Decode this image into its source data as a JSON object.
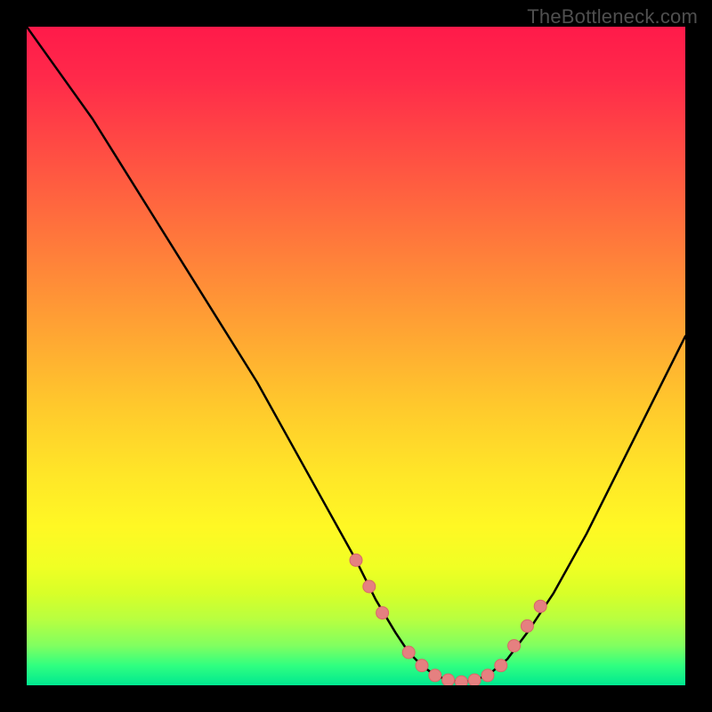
{
  "watermark": "TheBottleneck.com",
  "chart_data": {
    "type": "line",
    "title": "",
    "xlabel": "",
    "ylabel": "",
    "xlim": [
      0,
      100
    ],
    "ylim": [
      0,
      100
    ],
    "grid": false,
    "legend": false,
    "series": [
      {
        "name": "curve",
        "x": [
          0,
          5,
          10,
          15,
          20,
          25,
          30,
          35,
          40,
          45,
          50,
          53,
          56,
          58,
          60,
          62,
          64,
          66,
          68,
          70,
          73,
          76,
          80,
          85,
          90,
          95,
          100
        ],
        "y": [
          100,
          93,
          86,
          78,
          70,
          62,
          54,
          46,
          37,
          28,
          19,
          13,
          8,
          5,
          3,
          1.5,
          0.8,
          0.5,
          0.8,
          1.5,
          4,
          8,
          14,
          23,
          33,
          43,
          53
        ]
      }
    ],
    "dots": {
      "name": "highlight-points",
      "x": [
        50,
        52,
        54,
        58,
        60,
        62,
        64,
        66,
        68,
        70,
        72,
        74,
        76,
        78
      ],
      "y": [
        19,
        15,
        11,
        5,
        3,
        1.5,
        0.8,
        0.5,
        0.8,
        1.5,
        3,
        6,
        9,
        12
      ]
    },
    "colors": {
      "gradient_top": "#ff1a4a",
      "gradient_mid": "#ffe628",
      "gradient_bottom": "#00e890",
      "curve": "#000000",
      "dots": "#e58080"
    }
  }
}
